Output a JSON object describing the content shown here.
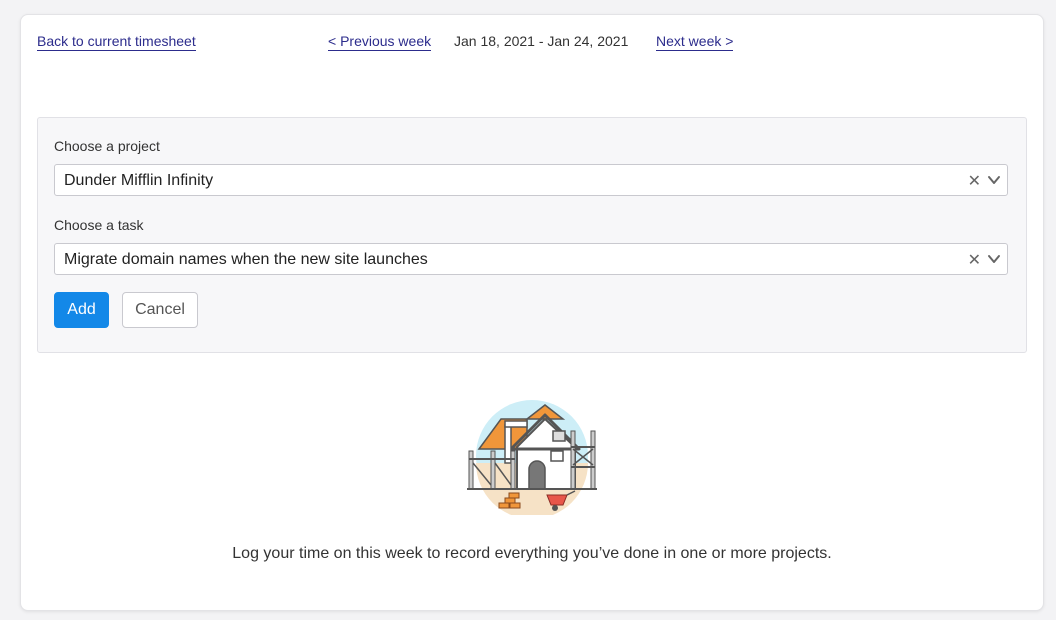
{
  "nav": {
    "back_label": "Back to current timesheet",
    "prev_label": "< Previous week",
    "date_range": "Jan 18, 2021 - Jan 24, 2021",
    "next_label": "Next week >"
  },
  "form": {
    "project_label": "Choose a project",
    "project_value": "Dunder Mifflin Infinity",
    "task_label": "Choose a task",
    "task_value": "Migrate domain names when the new site launches",
    "clear_symbol": "✕",
    "add_label": "Add",
    "cancel_label": "Cancel"
  },
  "empty_state": {
    "illustration_icon": "house-construction-illustration",
    "message": "Log your time on this week to record everything you’ve done in one or more projects."
  },
  "colors": {
    "primary": "#1388e8",
    "link": "#2c2c8c",
    "accent_orange": "#f0963a",
    "sky": "#cdeef7",
    "ground": "#f6e2c6"
  }
}
